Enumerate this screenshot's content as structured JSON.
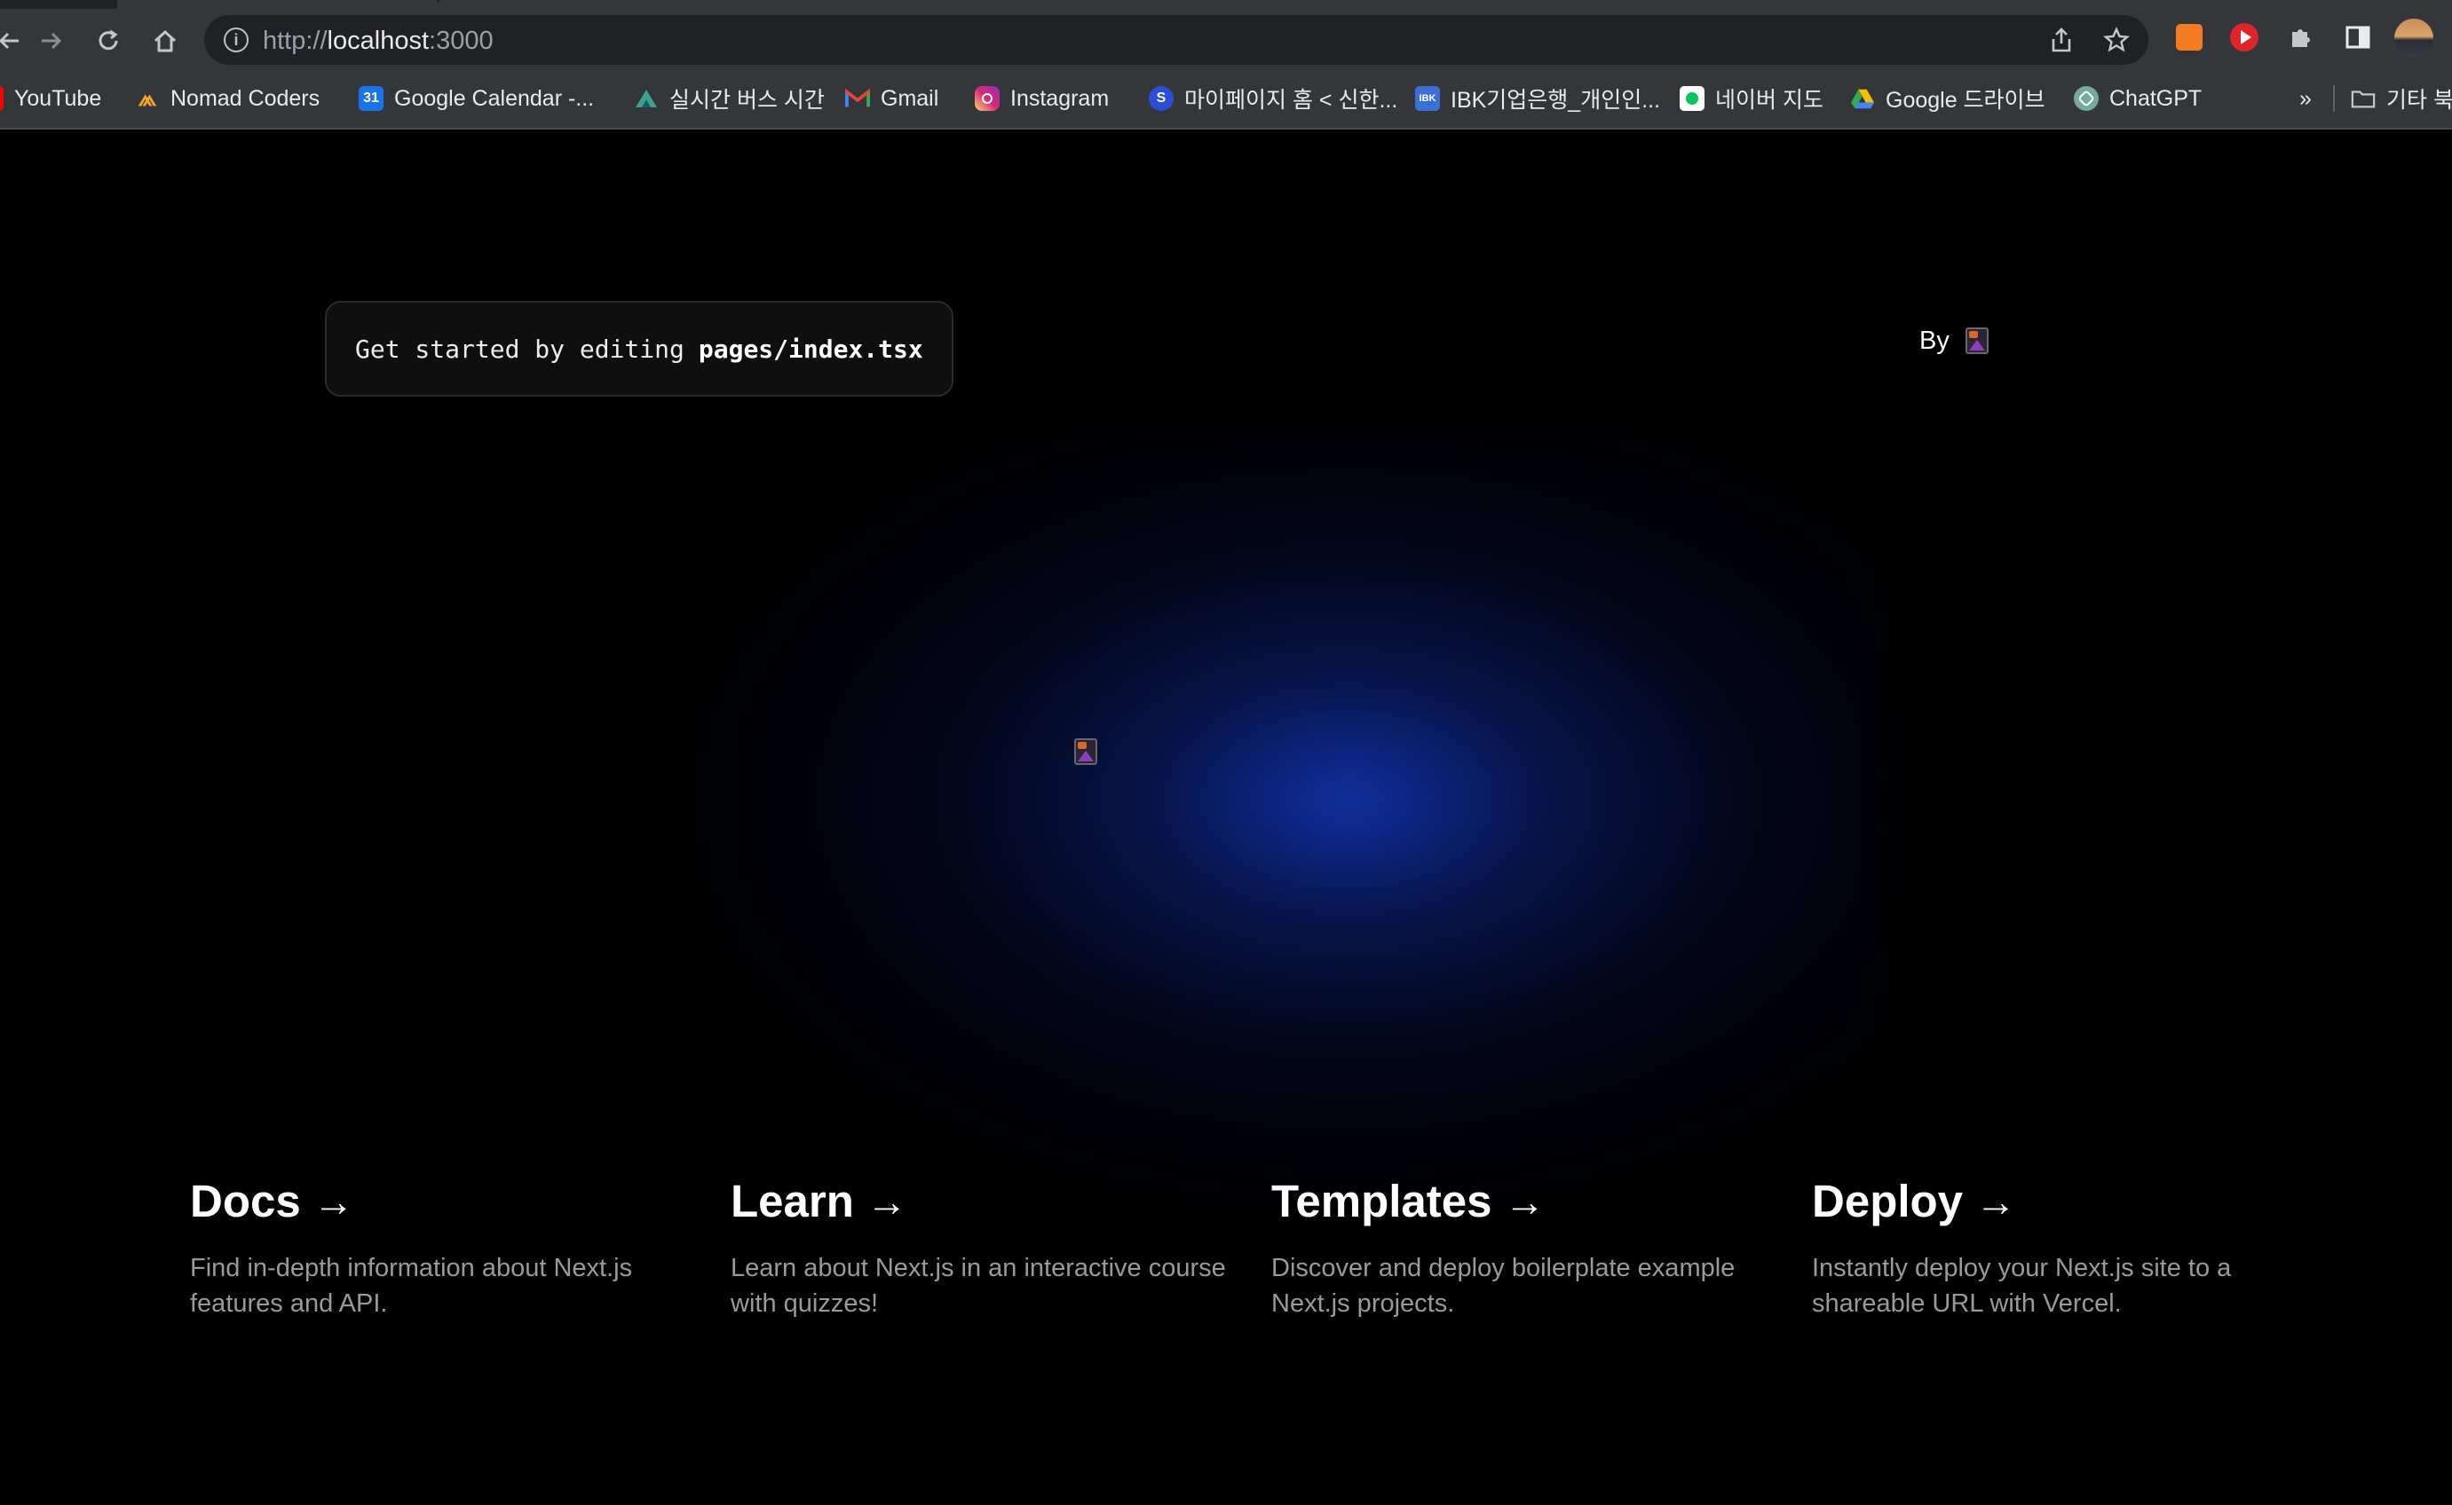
{
  "browser": {
    "url_scheme": "http://",
    "url_host": "localhost",
    "url_port": ":3000",
    "bookmarks": [
      {
        "label": "YouTube",
        "icon": "youtube-icon",
        "color": "#ff0000"
      },
      {
        "label": "Nomad Coders",
        "icon": "nomad-coders-icon",
        "color": "#f5a623"
      },
      {
        "label": "Google Calendar -...",
        "icon": "google-calendar-icon",
        "color": "#1a73e8"
      },
      {
        "label": "실시간 버스 시간",
        "icon": "bus-icon",
        "color": "#3ca38c"
      },
      {
        "label": "Gmail",
        "icon": "gmail-icon",
        "color": "#ea4335"
      },
      {
        "label": "Instagram",
        "icon": "instagram-icon",
        "color": "#d6249f"
      },
      {
        "label": "마이페이지 홈 < 신한...",
        "icon": "shinhan-icon",
        "color": "#2a4fd6"
      },
      {
        "label": "IBK기업은행_개인인...",
        "icon": "ibk-icon",
        "color": "#3b6fd6"
      },
      {
        "label": "네이버 지도",
        "icon": "naver-map-icon",
        "color": "#03c75a"
      },
      {
        "label": "Google 드라이브",
        "icon": "google-drive-icon",
        "color": "#fbbc04"
      },
      {
        "label": "ChatGPT",
        "icon": "chatgpt-icon",
        "color": "#74aa9c"
      }
    ],
    "overflow_label": "»",
    "other_bookmarks_label": "기타 북"
  },
  "page": {
    "code_prefix": "Get started by editing",
    "code_file": "pages/index.tsx",
    "by_label": "By",
    "cards": [
      {
        "title": "Docs",
        "arrow": "→",
        "desc": "Find in-depth information about Next.js features and API."
      },
      {
        "title": "Learn",
        "arrow": "→",
        "desc": "Learn about Next.js in an interactive course with quizzes!"
      },
      {
        "title": "Templates",
        "arrow": "→",
        "desc": "Discover and deploy boilerplate example Next.js projects."
      },
      {
        "title": "Deploy",
        "arrow": "→",
        "desc": "Instantly deploy your Next.js site to a shareable URL with Vercel."
      }
    ]
  }
}
